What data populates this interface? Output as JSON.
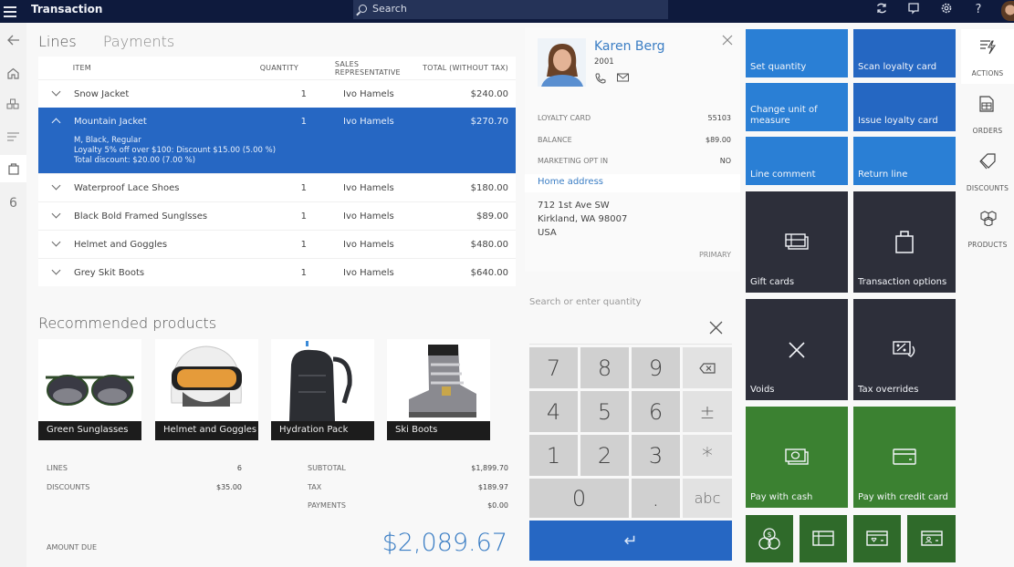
{
  "app": {
    "title": "Transaction",
    "search_placeholder": "Search",
    "top_icons": [
      "refresh-icon",
      "chat-icon",
      "settings-icon",
      "help-icon",
      "user-avatar"
    ]
  },
  "left_nav": {
    "items": [
      {
        "name": "back",
        "icon": "back-arrow-icon"
      },
      {
        "name": "home",
        "icon": "home-icon"
      },
      {
        "name": "products",
        "icon": "products-icon"
      },
      {
        "name": "menu",
        "icon": "list-icon"
      },
      {
        "name": "cart",
        "icon": "shopping-bag-icon",
        "active": true
      }
    ],
    "cart_count": "6"
  },
  "tabs": [
    {
      "label": "Lines",
      "active": true
    },
    {
      "label": "Payments",
      "active": false
    }
  ],
  "lines": {
    "headers": {
      "item": "ITEM",
      "quantity": "QUANTITY",
      "sales_rep": "SALES REPRESENTATIVE",
      "total": "TOTAL (WITHOUT TAX)"
    },
    "rows": [
      {
        "item": "Snow Jacket",
        "quantity": "1",
        "sales_rep": "Ivo Hamels",
        "total": "$240.00"
      },
      {
        "item": "Mountain Jacket",
        "quantity": "1",
        "sales_rep": "Ivo Hamels",
        "total": "$270.70",
        "selected": true,
        "details": [
          "M, Black, Regular",
          "Loyalty 5% off over $100: Discount $15.00 (5.00 %)",
          "Total discount: $20.00 (7.00 %)"
        ]
      },
      {
        "item": "Waterproof Lace Shoes",
        "quantity": "1",
        "sales_rep": "Ivo Hamels",
        "total": "$180.00"
      },
      {
        "item": "Black Bold Framed Sunglsses",
        "quantity": "1",
        "sales_rep": "Ivo Hamels",
        "total": "$89.00"
      },
      {
        "item": "Helmet and Goggles",
        "quantity": "1",
        "sales_rep": "Ivo Hamels",
        "total": "$480.00"
      },
      {
        "item": "Grey Skit Boots",
        "quantity": "1",
        "sales_rep": "Ivo Hamels",
        "total": "$640.00"
      }
    ]
  },
  "recommended": {
    "title": "Recommended products",
    "items": [
      {
        "label": "Green Sunglasses"
      },
      {
        "label": "Helmet and Goggles"
      },
      {
        "label": "Hydration Pack"
      },
      {
        "label": "Ski Boots"
      }
    ]
  },
  "totals": {
    "lines_label": "LINES",
    "lines_value": "6",
    "discounts_label": "DISCOUNTS",
    "discounts_value": "$35.00",
    "subtotal_label": "SUBTOTAL",
    "subtotal_value": "$1,899.70",
    "tax_label": "TAX",
    "tax_value": "$189.97",
    "payments_label": "PAYMENTS",
    "payments_value": "$0.00",
    "amount_due_label": "AMOUNT DUE",
    "amount_due_value": "$2,089.67"
  },
  "customer": {
    "name": "Karen Berg",
    "account": "2001",
    "fields": [
      {
        "label": "LOYALTY CARD",
        "value": "55103"
      },
      {
        "label": "BALANCE",
        "value": "$89.00"
      },
      {
        "label": "MARKETING OPT IN",
        "value": "NO"
      }
    ],
    "address_link": "Home address",
    "address_lines": [
      "712 1st Ave SW",
      "Kirkland, WA 98007",
      "USA"
    ],
    "address_tag": "PRIMARY"
  },
  "numpad": {
    "placeholder": "Search or enter quantity",
    "keys": [
      "7",
      "8",
      "9",
      "⌫",
      "4",
      "5",
      "6",
      "±",
      "1",
      "2",
      "3",
      "*",
      "0",
      ".",
      "abc",
      "↵"
    ]
  },
  "tiles": [
    {
      "label": "Set quantity",
      "style": "blue"
    },
    {
      "label": "Scan loyalty card",
      "style": "blue2"
    },
    {
      "label": "Change unit of measure",
      "style": "blue"
    },
    {
      "label": "Issue loyalty card",
      "style": "blue2"
    },
    {
      "label": "Line comment",
      "style": "blue"
    },
    {
      "label": "Return line",
      "style": "blue"
    },
    {
      "label": "Gift cards",
      "style": "dark",
      "icon": "gift-card-icon"
    },
    {
      "label": "Transaction options",
      "style": "dark",
      "icon": "shopping-bag-icon"
    },
    {
      "label": "Voids",
      "style": "dark",
      "icon": "close-icon"
    },
    {
      "label": "Tax overrides",
      "style": "dark",
      "icon": "tax-override-icon"
    },
    {
      "label": "Pay with cash",
      "style": "green",
      "icon": "cash-icon"
    },
    {
      "label": "Pay with credit card",
      "style": "green",
      "icon": "credit-card-icon"
    }
  ],
  "small_tiles": [
    {
      "icon": "currency-icon"
    },
    {
      "icon": "gift-card-icon"
    },
    {
      "icon": "loyalty-card-icon"
    },
    {
      "icon": "customer-account-icon"
    }
  ],
  "rail": [
    {
      "label": "ACTIONS",
      "icon": "actions-icon",
      "active": true
    },
    {
      "label": "ORDERS",
      "icon": "orders-icon"
    },
    {
      "label": "DISCOUNTS",
      "icon": "discounts-icon"
    },
    {
      "label": "PRODUCTS",
      "icon": "products-icon"
    }
  ],
  "colors": {
    "topbar": "#0e1a3d",
    "accent_blue": "#2667c3",
    "tile_blue": "#2a7fd5",
    "tile_dark": "#2d2f3a",
    "tile_green": "#3b8131",
    "amount_due": "#3a7dc4"
  }
}
